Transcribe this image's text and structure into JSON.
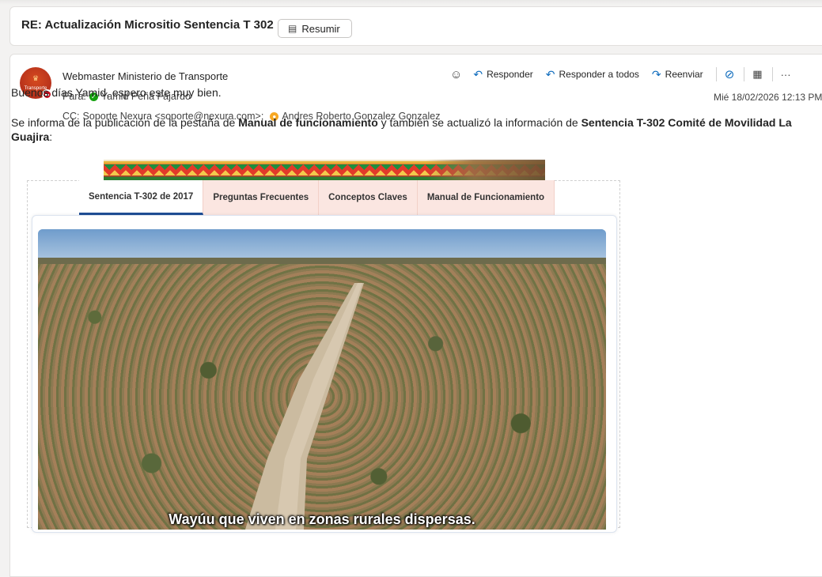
{
  "subject": {
    "title": "RE: Actualización Micrositio Sentencia T 302",
    "summarize_label": "Resumir",
    "summarize_icon": "summarize-icon"
  },
  "message": {
    "sender": {
      "name": "Webmaster Ministerio de Transporte",
      "avatar_label": "Transporte",
      "presence": "busy"
    },
    "to_label": "Para:",
    "to_name": "Yamid Peña Fajardo",
    "cc_label": "CC:",
    "cc_first": "Soporte Nexura <soporte@nexura.com>;",
    "cc_second": "Andres Roberto Gonzalez Gonzalez",
    "date": "Mié 18/02/2026 12:13 PM",
    "actions": {
      "reply": "Responder",
      "reply_all": "Responder a todos",
      "forward": "Reenviar"
    }
  },
  "body": {
    "greeting": "Buenos días Yamid, espero este muy bien.",
    "p1_a": "Se informa de la publicación de la pestaña de ",
    "p1_b": "Manual de funcionamiento",
    "p1_c": " y también se actualizó la información de ",
    "p1_d": "Sentencia T-302 Comité de Movilidad La Guajira",
    "p1_e": ":"
  },
  "embed": {
    "tabs": [
      {
        "label": "Sentencia T-302 de 2017",
        "active": true
      },
      {
        "label": "Preguntas Frecuentes",
        "active": false
      },
      {
        "label": "Conceptos Claves",
        "active": false
      },
      {
        "label": "Manual de Funcionamiento",
        "active": false
      }
    ],
    "video_caption": "Wayúu que viven en zonas rurales dispersas."
  },
  "colors": {
    "accent": "#0f6cbd",
    "tab_active_border": "#1f4e96",
    "tab_bg": "#fbe6e1"
  }
}
